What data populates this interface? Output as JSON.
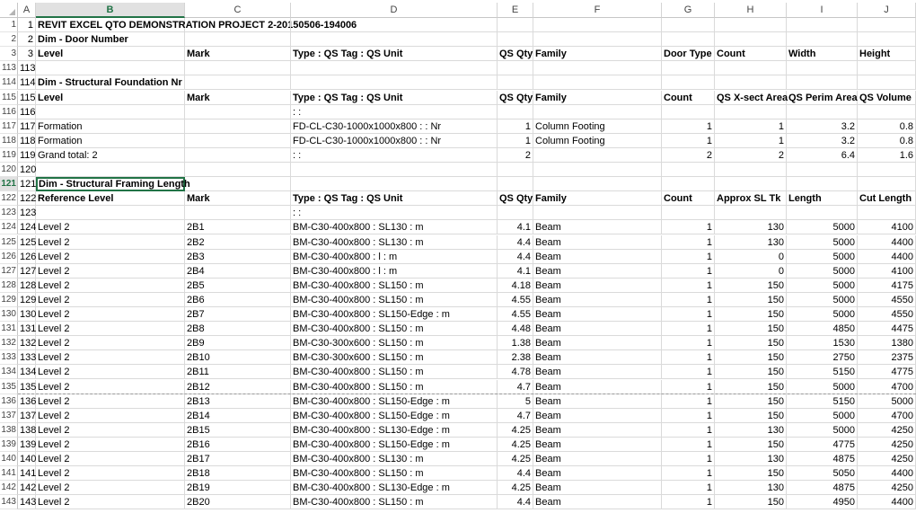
{
  "columns": [
    "A",
    "B",
    "C",
    "D",
    "E",
    "F",
    "G",
    "H",
    "I",
    "J"
  ],
  "selected_column": "B",
  "selected_row": "121",
  "rows": [
    {
      "n": "1",
      "bold": true,
      "cells": {
        "A": "1",
        "B": "REVIT EXCEL QTO DEMONSTRATION PROJECT 2-20150506-194006"
      }
    },
    {
      "n": "2",
      "bold": true,
      "cells": {
        "A": "2",
        "B": "Dim - Door Number"
      }
    },
    {
      "n": "3",
      "bold": true,
      "cells": {
        "A": "3",
        "B": "Level",
        "C": "Mark",
        "D": "Type : QS Tag : QS Unit",
        "E": "QS Qty",
        "F": "Family",
        "G": "Door Type",
        "H": "Count",
        "I": "Width",
        "J": "Height"
      }
    },
    {
      "n": "113",
      "cells": {
        "A": "113"
      }
    },
    {
      "n": "114",
      "bold": true,
      "cells": {
        "A": "114",
        "B": "Dim - Structural Foundation Nr"
      }
    },
    {
      "n": "115",
      "bold": true,
      "cells": {
        "A": "115",
        "B": "Level",
        "C": "Mark",
        "D": "Type : QS Tag : QS Unit",
        "E": "QS Qty",
        "F": "Family",
        "G": "Count",
        "H": "QS X-sect Area",
        "I": "QS Perim Area",
        "J": "QS Volume"
      }
    },
    {
      "n": "116",
      "cells": {
        "A": "116",
        "D": ": :"
      }
    },
    {
      "n": "117",
      "cells": {
        "A": "117",
        "B": "Formation",
        "D": "FD-CL-C30-1000x1000x800 : : Nr",
        "E": "1",
        "F": "Column Footing",
        "G": "1",
        "H": "1",
        "I": "3.2",
        "J": "0.8"
      }
    },
    {
      "n": "118",
      "cells": {
        "A": "118",
        "B": "Formation",
        "D": "FD-CL-C30-1000x1000x800 : : Nr",
        "E": "1",
        "F": "Column Footing",
        "G": "1",
        "H": "1",
        "I": "3.2",
        "J": "0.8"
      }
    },
    {
      "n": "119",
      "cells": {
        "A": "119",
        "B": "Grand total: 2",
        "D": ": :",
        "E": "2",
        "G": "2",
        "H": "2",
        "I": "6.4",
        "J": "1.6"
      }
    },
    {
      "n": "120",
      "cells": {
        "A": "120"
      }
    },
    {
      "n": "121",
      "bold": true,
      "cells": {
        "A": "121",
        "B": "Dim - Structural Framing Length"
      }
    },
    {
      "n": "122",
      "bold": true,
      "cells": {
        "A": "122",
        "B": "Reference Level",
        "C": "Mark",
        "D": "Type : QS Tag : QS Unit",
        "E": "QS Qty",
        "F": "Family",
        "G": "Count",
        "H": "Approx SL Tk",
        "I": "Length",
        "J": "Cut Length"
      }
    },
    {
      "n": "123",
      "cells": {
        "A": "123",
        "D": ": :"
      }
    },
    {
      "n": "124",
      "cells": {
        "A": "124",
        "B": "Level 2",
        "C": "2B1",
        "D": "BM-C30-400x800 : SL130 : m",
        "E": "4.1",
        "F": "Beam",
        "G": "1",
        "H": "130",
        "I": "5000",
        "J": "4100"
      }
    },
    {
      "n": "125",
      "cells": {
        "A": "125",
        "B": "Level 2",
        "C": "2B2",
        "D": "BM-C30-400x800 : SL130 : m",
        "E": "4.4",
        "F": "Beam",
        "G": "1",
        "H": "130",
        "I": "5000",
        "J": "4400"
      }
    },
    {
      "n": "126",
      "cells": {
        "A": "126",
        "B": "Level 2",
        "C": "2B3",
        "D": "BM-C30-400x800 : l : m",
        "E": "4.4",
        "F": "Beam",
        "G": "1",
        "H": "0",
        "I": "5000",
        "J": "4400"
      }
    },
    {
      "n": "127",
      "cells": {
        "A": "127",
        "B": "Level 2",
        "C": "2B4",
        "D": "BM-C30-400x800 : l : m",
        "E": "4.1",
        "F": "Beam",
        "G": "1",
        "H": "0",
        "I": "5000",
        "J": "4100"
      }
    },
    {
      "n": "128",
      "cells": {
        "A": "128",
        "B": "Level 2",
        "C": "2B5",
        "D": "BM-C30-400x800 : SL150 : m",
        "E": "4.18",
        "F": "Beam",
        "G": "1",
        "H": "150",
        "I": "5000",
        "J": "4175"
      }
    },
    {
      "n": "129",
      "cells": {
        "A": "129",
        "B": "Level 2",
        "C": "2B6",
        "D": "BM-C30-400x800 : SL150 : m",
        "E": "4.55",
        "F": "Beam",
        "G": "1",
        "H": "150",
        "I": "5000",
        "J": "4550"
      }
    },
    {
      "n": "130",
      "cells": {
        "A": "130",
        "B": "Level 2",
        "C": "2B7",
        "D": "BM-C30-400x800 : SL150-Edge : m",
        "E": "4.55",
        "F": "Beam",
        "G": "1",
        "H": "150",
        "I": "5000",
        "J": "4550"
      }
    },
    {
      "n": "131",
      "cells": {
        "A": "131",
        "B": "Level 2",
        "C": "2B8",
        "D": "BM-C30-400x800 : SL150 : m",
        "E": "4.48",
        "F": "Beam",
        "G": "1",
        "H": "150",
        "I": "4850",
        "J": "4475"
      }
    },
    {
      "n": "132",
      "cells": {
        "A": "132",
        "B": "Level 2",
        "C": "2B9",
        "D": "BM-C30-300x600 : SL150 : m",
        "E": "1.38",
        "F": "Beam",
        "G": "1",
        "H": "150",
        "I": "1530",
        "J": "1380"
      }
    },
    {
      "n": "133",
      "cells": {
        "A": "133",
        "B": "Level 2",
        "C": "2B10",
        "D": "BM-C30-300x600 : SL150 : m",
        "E": "2.38",
        "F": "Beam",
        "G": "1",
        "H": "150",
        "I": "2750",
        "J": "2375"
      }
    },
    {
      "n": "134",
      "cells": {
        "A": "134",
        "B": "Level 2",
        "C": "2B11",
        "D": "BM-C30-400x800 : SL150 : m",
        "E": "4.78",
        "F": "Beam",
        "G": "1",
        "H": "150",
        "I": "5150",
        "J": "4775"
      }
    },
    {
      "n": "135",
      "cells": {
        "A": "135",
        "B": "Level 2",
        "C": "2B12",
        "D": "BM-C30-400x800 : SL150 : m",
        "E": "4.7",
        "F": "Beam",
        "G": "1",
        "H": "150",
        "I": "5000",
        "J": "4700"
      }
    },
    {
      "n": "136",
      "cells": {
        "A": "136",
        "B": "Level 2",
        "C": "2B13",
        "D": "BM-C30-400x800 : SL150-Edge : m",
        "E": "5",
        "F": "Beam",
        "G": "1",
        "H": "150",
        "I": "5150",
        "J": "5000"
      }
    },
    {
      "n": "137",
      "cells": {
        "A": "137",
        "B": "Level 2",
        "C": "2B14",
        "D": "BM-C30-400x800 : SL150-Edge : m",
        "E": "4.7",
        "F": "Beam",
        "G": "1",
        "H": "150",
        "I": "5000",
        "J": "4700"
      }
    },
    {
      "n": "138",
      "cells": {
        "A": "138",
        "B": "Level 2",
        "C": "2B15",
        "D": "BM-C30-400x800 : SL130-Edge : m",
        "E": "4.25",
        "F": "Beam",
        "G": "1",
        "H": "130",
        "I": "5000",
        "J": "4250"
      }
    },
    {
      "n": "139",
      "cells": {
        "A": "139",
        "B": "Level 2",
        "C": "2B16",
        "D": "BM-C30-400x800 : SL150-Edge : m",
        "E": "4.25",
        "F": "Beam",
        "G": "1",
        "H": "150",
        "I": "4775",
        "J": "4250"
      }
    },
    {
      "n": "140",
      "cells": {
        "A": "140",
        "B": "Level 2",
        "C": "2B17",
        "D": "BM-C30-400x800 : SL130 : m",
        "E": "4.25",
        "F": "Beam",
        "G": "1",
        "H": "130",
        "I": "4875",
        "J": "4250"
      }
    },
    {
      "n": "141",
      "cells": {
        "A": "141",
        "B": "Level 2",
        "C": "2B18",
        "D": "BM-C30-400x800 : SL150 : m",
        "E": "4.4",
        "F": "Beam",
        "G": "1",
        "H": "150",
        "I": "5050",
        "J": "4400"
      }
    },
    {
      "n": "142",
      "cells": {
        "A": "142",
        "B": "Level 2",
        "C": "2B19",
        "D": "BM-C30-400x800 : SL130-Edge : m",
        "E": "4.25",
        "F": "Beam",
        "G": "1",
        "H": "130",
        "I": "4875",
        "J": "4250"
      }
    },
    {
      "n": "143",
      "cells": {
        "A": "143",
        "B": "Level 2",
        "C": "2B20",
        "D": "BM-C30-400x800 : SL150 : m",
        "E": "4.4",
        "F": "Beam",
        "G": "1",
        "H": "150",
        "I": "4950",
        "J": "4400"
      }
    }
  ]
}
